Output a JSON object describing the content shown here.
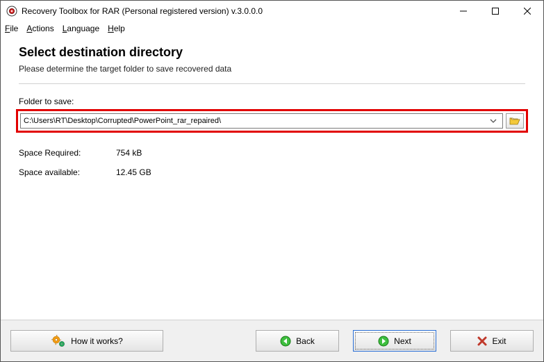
{
  "title": "Recovery Toolbox for RAR (Personal registered version) v.3.0.0.0",
  "menus": {
    "file": "File",
    "actions": "Actions",
    "language": "Language",
    "help": "Help"
  },
  "header": {
    "title": "Select destination directory",
    "subtitle": "Please determine the target folder to save recovered data"
  },
  "folder": {
    "label": "Folder to save:",
    "value": "C:\\Users\\RT\\Desktop\\Corrupted\\PowerPoint_rar_repaired\\"
  },
  "stats": {
    "required_label": "Space Required:",
    "required_value": "754 kB",
    "available_label": "Space available:",
    "available_value": "12.45 GB"
  },
  "buttons": {
    "howitworks": "How it works?",
    "back": "Back",
    "next": "Next",
    "exit": "Exit"
  }
}
